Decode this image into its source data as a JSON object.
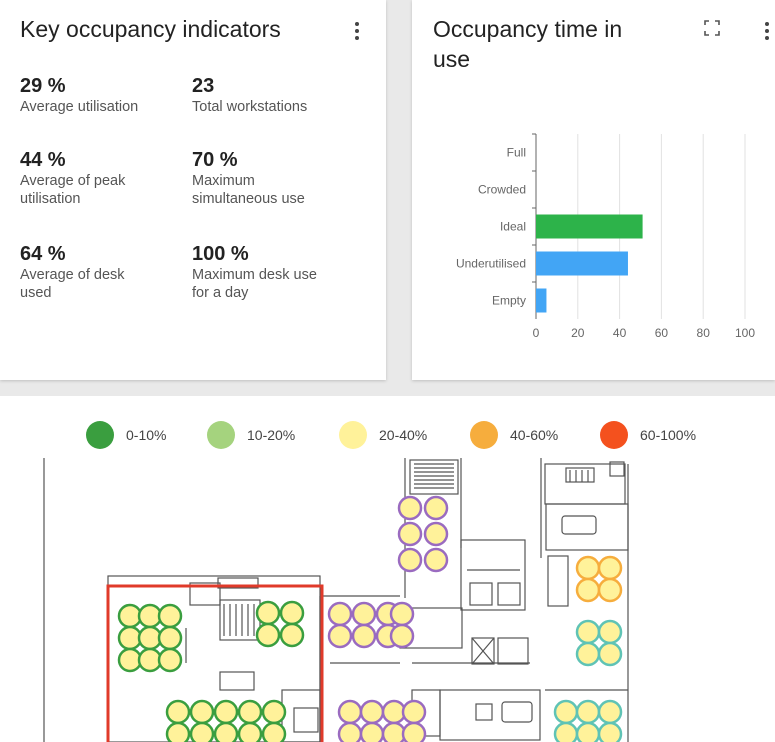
{
  "kpi_card": {
    "title": "Key occupancy indicators",
    "indicators": [
      {
        "value": "29 %",
        "label": [
          "Average utilisation"
        ]
      },
      {
        "value": "23",
        "label": [
          "Total workstations"
        ]
      },
      {
        "value": "44 %",
        "label": [
          "Average of peak",
          "utilisation"
        ]
      },
      {
        "value": "70 %",
        "label": [
          "Maximum",
          "simultaneous use"
        ]
      },
      {
        "value": "64 %",
        "label": [
          "Average of desk",
          "used"
        ]
      },
      {
        "value": "100 %",
        "label": [
          "Maximum desk use",
          "for a day"
        ]
      }
    ]
  },
  "chart_card": {
    "title_line1": "Occupancy time in",
    "title_line2": "use"
  },
  "chart_data": {
    "type": "bar",
    "orientation": "horizontal",
    "categories": [
      "Full",
      "Crowded",
      "Ideal",
      "Underutilised",
      "Empty"
    ],
    "values": [
      0,
      0,
      51,
      44,
      5
    ],
    "colors": [
      "#2db34a",
      "#2db34a",
      "#2db34a",
      "#42a5f5",
      "#42a5f5"
    ],
    "xlim": [
      0,
      100
    ],
    "xticks": [
      "0",
      "20",
      "40",
      "60",
      "80",
      "100"
    ],
    "grid": true
  },
  "legend": [
    {
      "label": "0-10%",
      "color": "#3a9e3f"
    },
    {
      "label": "10-20%",
      "color": "#a5d37e"
    },
    {
      "label": "20-40%",
      "color": "#fff29a"
    },
    {
      "label": "40-60%",
      "color": "#f6ad3d"
    },
    {
      "label": "60-100%",
      "color": "#f4511e"
    }
  ],
  "floor_plan": {
    "seat_colors": {
      "fill": "#fff29a",
      "green": "#3a9e3f",
      "purple": "#9a6bc0",
      "teal": "#5fc3b5",
      "orange": "#f6ad3d",
      "highlight": "#e03a2a"
    }
  }
}
